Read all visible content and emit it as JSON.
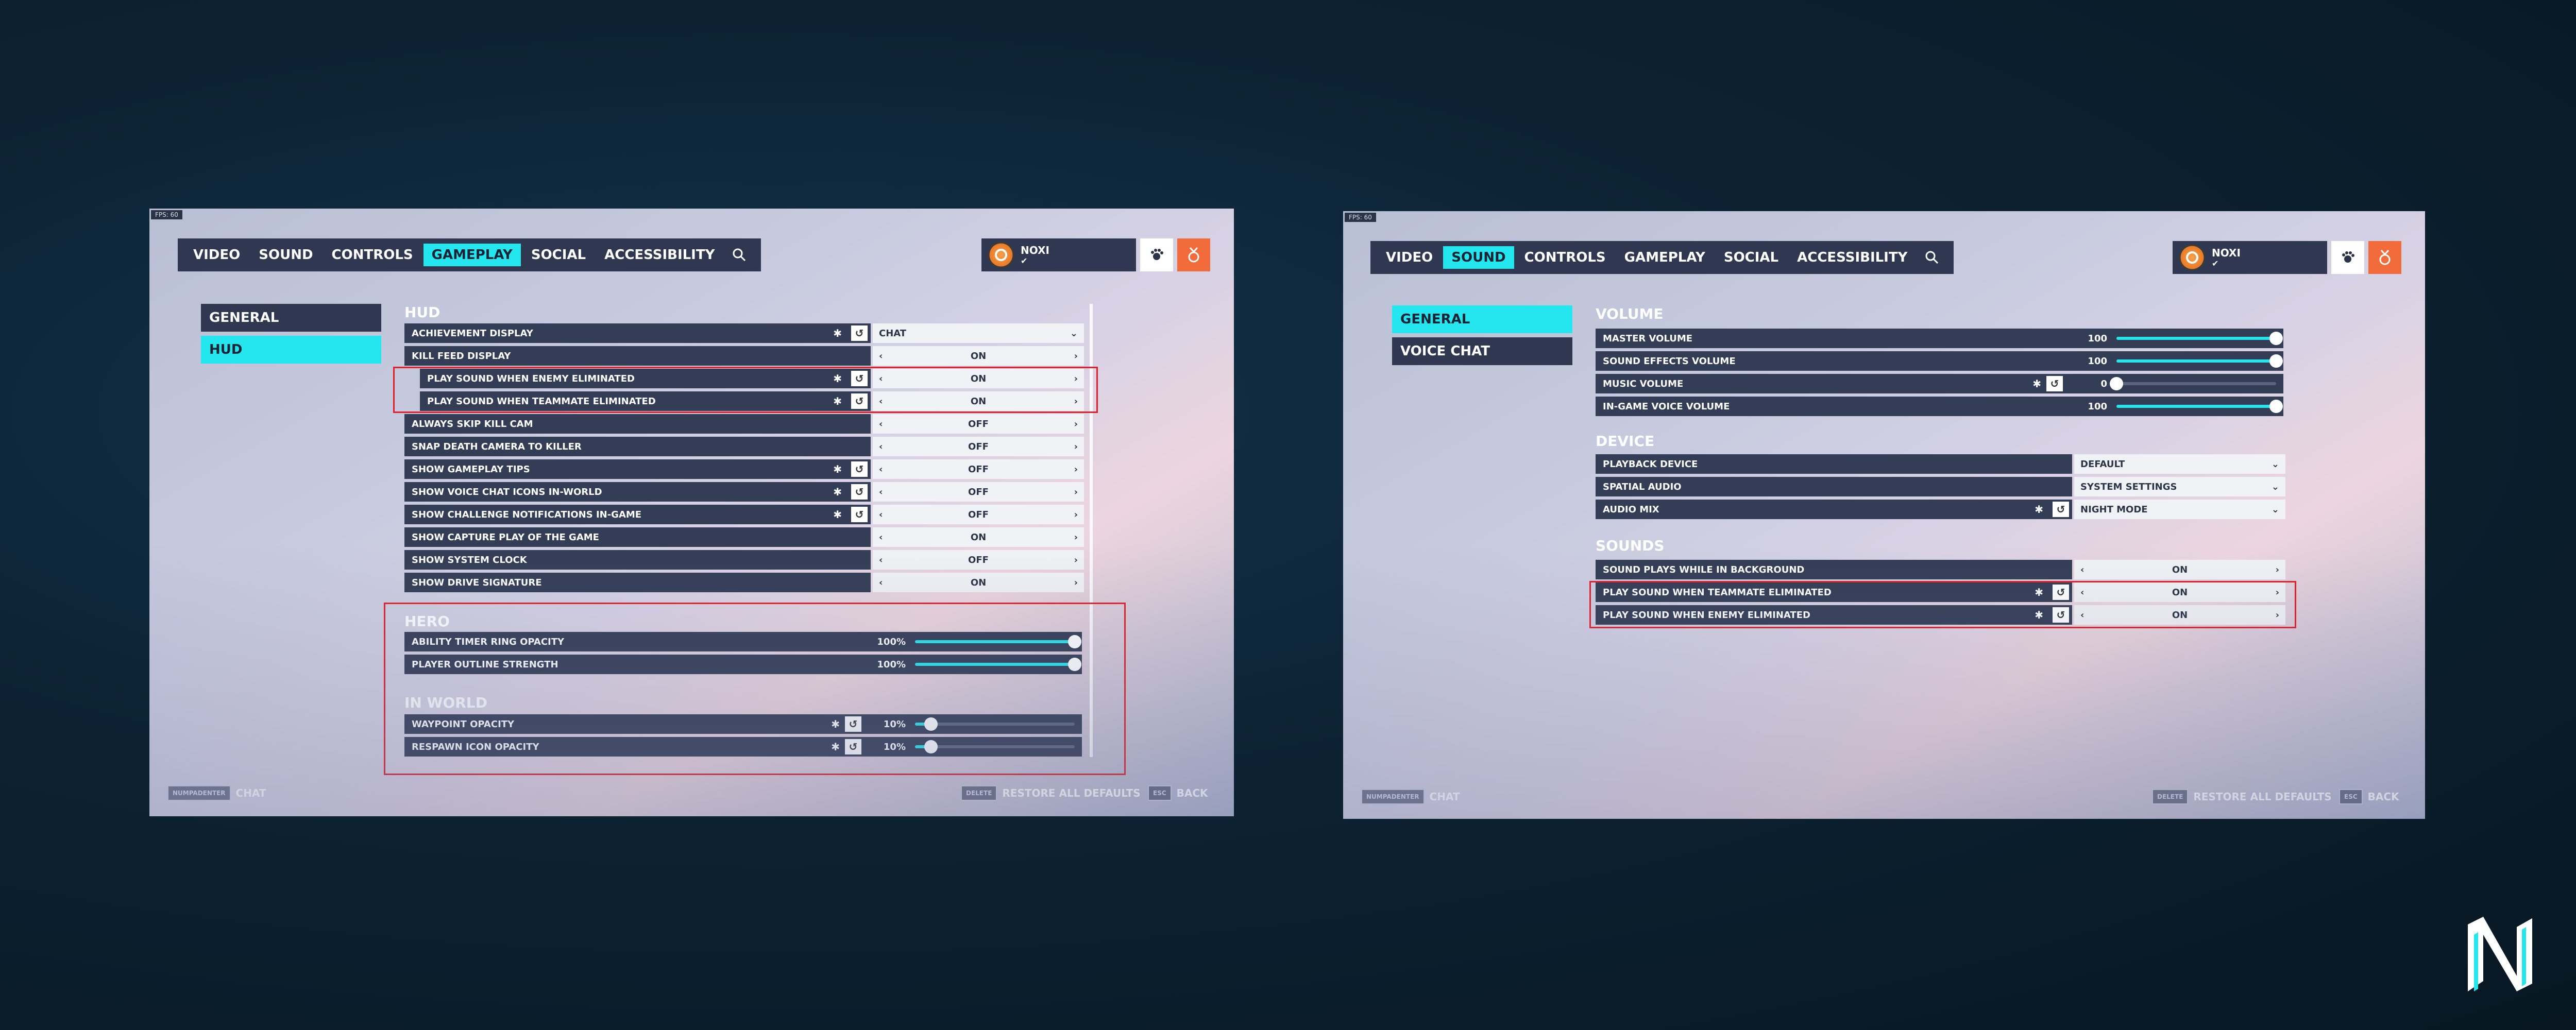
{
  "shared": {
    "fps": "FPS: 60",
    "player_name": "NOXI",
    "tabs": [
      "VIDEO",
      "SOUND",
      "CONTROLS",
      "GAMEPLAY",
      "SOCIAL",
      "ACCESSIBILITY"
    ],
    "footer": {
      "chat_key": "NUMPADENTER",
      "chat": "CHAT",
      "restore_key": "DELETE",
      "restore": "RESTORE ALL DEFAULTS",
      "back_key": "ESC",
      "back": "BACK"
    },
    "colors": {
      "accent": "#23e6ee",
      "highlight": "#e0202a",
      "row_bg": "#333d55",
      "value_bg": "#f1f2f5"
    }
  },
  "left": {
    "active_tab": "GAMEPLAY",
    "sidebar": [
      "GENERAL",
      "HUD"
    ],
    "active_sidebar": "HUD",
    "section_hud": "HUD",
    "hud_rows": [
      {
        "label": "ACHIEVEMENT DISPLAY",
        "value": "CHAT",
        "modified": true,
        "type": "dropdown"
      },
      {
        "label": "KILL FEED DISPLAY",
        "value": "ON",
        "modified": false,
        "type": "toggle"
      },
      {
        "label": "PLAY SOUND WHEN ENEMY ELIMINATED",
        "value": "ON",
        "modified": true,
        "type": "toggle"
      },
      {
        "label": "PLAY SOUND WHEN TEAMMATE ELIMINATED",
        "value": "ON",
        "modified": true,
        "type": "toggle"
      },
      {
        "label": "ALWAYS SKIP KILL CAM",
        "value": "OFF",
        "modified": false,
        "type": "toggle"
      },
      {
        "label": "SNAP DEATH CAMERA TO KILLER",
        "value": "OFF",
        "modified": false,
        "type": "toggle"
      },
      {
        "label": "SHOW GAMEPLAY TIPS",
        "value": "OFF",
        "modified": true,
        "type": "toggle"
      },
      {
        "label": "SHOW VOICE CHAT ICONS IN-WORLD",
        "value": "OFF",
        "modified": true,
        "type": "toggle"
      },
      {
        "label": "SHOW CHALLENGE NOTIFICATIONS IN-GAME",
        "value": "OFF",
        "modified": true,
        "type": "toggle"
      },
      {
        "label": "SHOW CAPTURE PLAY OF THE GAME",
        "value": "ON",
        "modified": false,
        "type": "toggle"
      },
      {
        "label": "SHOW SYSTEM CLOCK",
        "value": "OFF",
        "modified": false,
        "type": "toggle"
      },
      {
        "label": "SHOW DRIVE SIGNATURE",
        "value": "ON",
        "modified": false,
        "type": "toggle"
      }
    ],
    "section_hero": "HERO",
    "hero_rows": [
      {
        "label": "ABILITY TIMER RING OPACITY",
        "value": "100%",
        "level": 1.0,
        "modified": false
      },
      {
        "label": "PLAYER OUTLINE STRENGTH",
        "value": "100%",
        "level": 1.0,
        "modified": false
      }
    ],
    "section_world": "IN WORLD",
    "world_rows": [
      {
        "label": "WAYPOINT OPACITY",
        "value": "10%",
        "level": 0.1,
        "modified": true
      },
      {
        "label": "RESPAWN ICON OPACITY",
        "value": "10%",
        "level": 0.1,
        "modified": true
      }
    ]
  },
  "right": {
    "active_tab": "SOUND",
    "sidebar": [
      "GENERAL",
      "VOICE CHAT"
    ],
    "active_sidebar": "GENERAL",
    "section_volume": "VOLUME",
    "volume_rows": [
      {
        "label": "MASTER VOLUME",
        "value": "100",
        "level": 1.0,
        "modified": false
      },
      {
        "label": "SOUND EFFECTS VOLUME",
        "value": "100",
        "level": 1.0,
        "modified": false
      },
      {
        "label": "MUSIC VOLUME",
        "value": "0",
        "level": 0.0,
        "modified": true
      },
      {
        "label": "IN-GAME VOICE VOLUME",
        "value": "100",
        "level": 1.0,
        "modified": false
      }
    ],
    "section_device": "DEVICE",
    "device_rows": [
      {
        "label": "PLAYBACK DEVICE",
        "value": "DEFAULT",
        "modified": false
      },
      {
        "label": "SPATIAL AUDIO",
        "value": "SYSTEM SETTINGS",
        "modified": false
      },
      {
        "label": "AUDIO MIX",
        "value": "NIGHT MODE",
        "modified": true
      }
    ],
    "section_sounds": "SOUNDS",
    "sounds_rows": [
      {
        "label": "SOUND PLAYS WHILE IN BACKGROUND",
        "value": "ON",
        "modified": false
      },
      {
        "label": "PLAY SOUND WHEN TEAMMATE ELIMINATED",
        "value": "ON",
        "modified": true
      },
      {
        "label": "PLAY SOUND WHEN ENEMY ELIMINATED",
        "value": "ON",
        "modified": true
      }
    ]
  }
}
